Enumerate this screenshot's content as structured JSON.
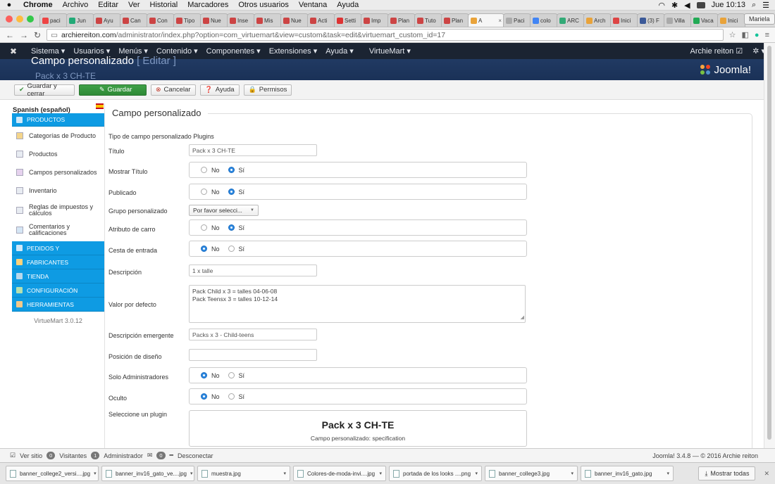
{
  "mac_menubar": {
    "items": [
      "Chrome",
      "Archivo",
      "Editar",
      "Ver",
      "Historial",
      "Marcadores",
      "Otros usuarios",
      "Ventana",
      "Ayuda"
    ],
    "clock": "Jue 10:13"
  },
  "browser": {
    "tabs": [
      "paci",
      "Jun",
      "Ayu",
      "Can",
      "Con",
      "Tipo",
      "Nue",
      "Inse",
      "Mis",
      "Nue",
      "Acti",
      "Setti",
      "Imp",
      "Plan",
      "Tuto",
      "Plan",
      "A",
      "Paci",
      "colo",
      "ARC",
      "Arch",
      "Inici",
      "(3) F",
      "Villa",
      "Vaca",
      "Inici"
    ],
    "user": "Mariela",
    "url_host": "archiereiton.com",
    "url_path": "/administrator/index.php?option=com_virtuemart&view=custom&task=edit&virtuemart_custom_id=17"
  },
  "joomla_nav": {
    "menus": [
      "Sistema ▾",
      "Usuarios ▾",
      "Menús ▾",
      "Contenido ▾",
      "Componentes ▾",
      "Extensiones ▾",
      "Ayuda ▾",
      "VirtueMart ▾"
    ],
    "user": "Archie reiton ☑",
    "gear": "✲ ▾"
  },
  "header": {
    "title": "Campo personalizado",
    "edit": "[ Editar ]",
    "subtitle": "Pack x 3 CH-TE",
    "brand": "Joomla!"
  },
  "toolbar": {
    "save_close": "Guardar y cerrar",
    "save": "Guardar",
    "cancel": "Cancelar",
    "help": "Ayuda",
    "permissions": "Permisos"
  },
  "sidebar": {
    "language": "Spanish (español)",
    "section_products": "PRODUCTOS",
    "products_items": [
      "Categorías de Producto",
      "Productos",
      "Campos personalizados",
      "Inventario",
      "Reglas de impuestos y cálculos",
      "Comentarios y calificaciones"
    ],
    "sections": [
      "PEDIDOS Y",
      "FABRICANTES",
      "TIENDA",
      "CONFIGURACIÓN",
      "HERRAMIENTAS"
    ],
    "version": "VirtueMart 3.0.12"
  },
  "form": {
    "legend": "Campo personalizado",
    "type_label": "Tipo de campo personalizado",
    "type_value": "Plugins",
    "titulo_label": "Título",
    "titulo_value": "Pack x 3 CH-TE",
    "mostrar_label": "Mostrar Título",
    "publicado_label": "Publicado",
    "grupo_label": "Grupo personalizado",
    "grupo_value": "Por favor selecci...",
    "atributo_label": "Atributo de carro",
    "cesta_label": "Cesta de entrada",
    "descripcion_label": "Descripción",
    "descripcion_value": "1 x talle",
    "valor_label": "Valor por defecto",
    "valor_line1": "Pack Child x 3  = talles 04-06-08",
    "valor_line2": "Pack Teensx 3  = talles 10-12-14",
    "emergente_label": "Descripción emergente",
    "emergente_value": "Packs x 3 - Child-teens",
    "posicion_label": "Posición de diseño",
    "solo_label": "Solo Administradores",
    "oculto_label": "Oculto",
    "plugin_label": "Seleccione un plugin",
    "plugin_title": "Pack x 3 CH-TE",
    "plugin_sub": "Campo personalizado: specification",
    "no": "No",
    "si": "Sí"
  },
  "footer": {
    "ver_sitio": "Ver sitio",
    "visitantes_count": "0",
    "visitantes": "Visitantes",
    "admin_count": "1",
    "administrador": "Administrador",
    "msg_count": "0",
    "desconectar": "Desconectar",
    "copyright": "Joomla! 3.4.8  —  © 2016 Archie reiton"
  },
  "downloads": {
    "files": [
      "banner_college2_versi....jpg",
      "banner_inv16_gato_ve....jpg",
      "muestra.jpg",
      "Colores-de-moda-invi....jpg",
      "portada de los looks ....png",
      "banner_college3.jpg",
      "banner_inv16_gato.jpg"
    ],
    "show_all": "Mostrar todas"
  },
  "colors": {
    "joomla_nav": "#1b2432",
    "header": "#1a3157",
    "sidebar_section": "#0e9be3",
    "save_green": "#2e8a36",
    "radio_on": "#2b87e0"
  }
}
